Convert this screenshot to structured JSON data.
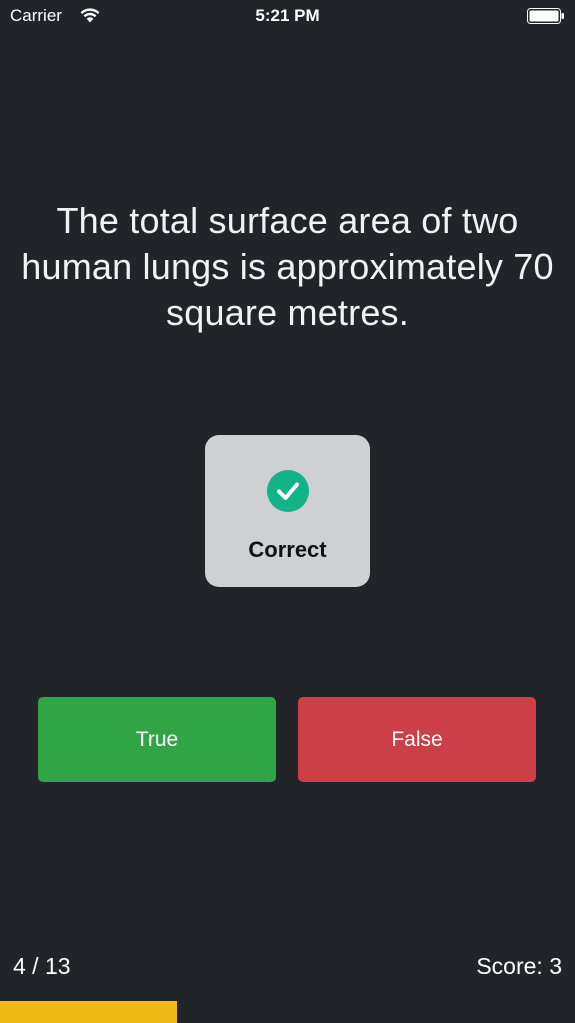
{
  "status_bar": {
    "carrier": "Carrier",
    "time": "5:21 PM",
    "wifi_icon": "wifi-icon",
    "battery_icon": "battery-icon"
  },
  "question": {
    "text": "The total surface area of two human lungs is approximately 70 square metres."
  },
  "hud": {
    "icon": "checkmark-circle-icon",
    "label": "Correct",
    "icon_color": "#13b38a"
  },
  "answers": {
    "true_label": "True",
    "false_label": "False",
    "true_color": "#31a546",
    "false_color": "#cc3f47"
  },
  "footer": {
    "progress_label": "4 / 13",
    "score_label": "Score: 3",
    "current_question": 4,
    "total_questions": 13,
    "progress_fraction": 0.308,
    "progress_color": "#f0bb17"
  }
}
